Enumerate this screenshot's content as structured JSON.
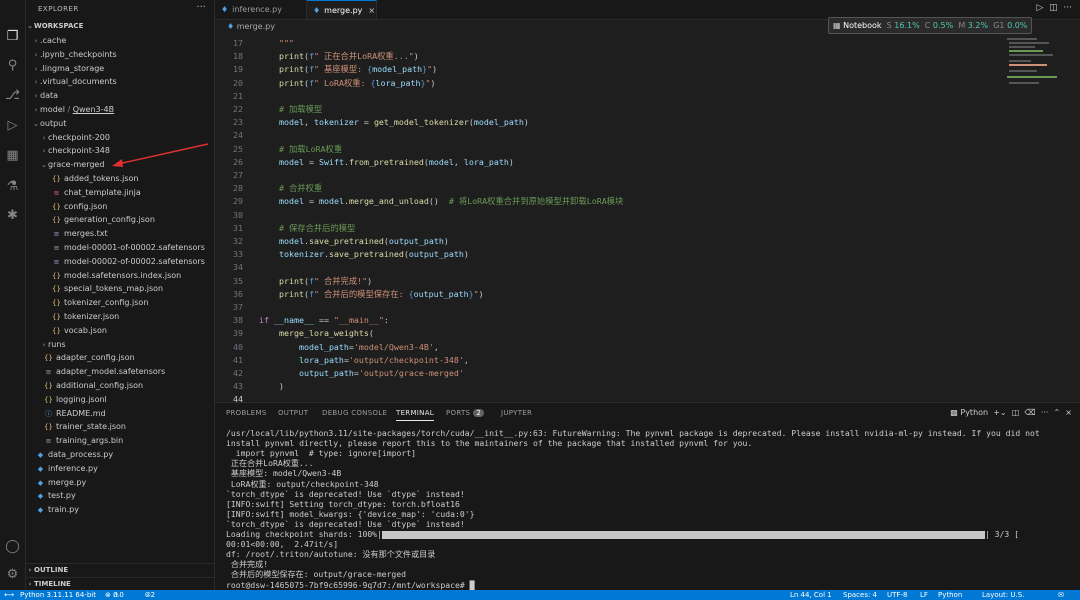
{
  "sidebar": {
    "title": "EXPLORER",
    "workspace": "WORKSPACE",
    "outline": "OUTLINE",
    "timeline": "TIMELINE",
    "items": [
      {
        "label": "cache-folder",
        "text": ".cache",
        "depth": 1,
        "type": "folder",
        "open": false
      },
      {
        "label": "ipynb",
        "text": ".ipynb_checkpoints",
        "depth": 1,
        "type": "folder",
        "open": false
      },
      {
        "label": "lingma",
        "text": ".lingma_storage",
        "depth": 1,
        "type": "folder",
        "open": false
      },
      {
        "label": "virtual-docs",
        "text": ".virtual_documents",
        "depth": 1,
        "type": "folder",
        "open": false
      },
      {
        "label": "data",
        "text": "data",
        "depth": 1,
        "type": "folder",
        "open": false
      },
      {
        "label": "model",
        "text": "model",
        "sub": "Qwen3-4B",
        "depth": 1,
        "type": "folder",
        "open": false
      },
      {
        "label": "output",
        "text": "output",
        "depth": 1,
        "type": "folder",
        "open": true
      },
      {
        "label": "checkpoint-200",
        "text": "checkpoint-200",
        "depth": 2,
        "type": "folder",
        "open": false
      },
      {
        "label": "checkpoint-348",
        "text": "checkpoint-348",
        "depth": 2,
        "type": "folder",
        "open": false
      },
      {
        "label": "grace-merged",
        "text": "grace-merged",
        "depth": 2,
        "type": "folder",
        "open": true
      },
      {
        "label": "added-tokens",
        "text": "added_tokens.json",
        "depth": 3,
        "type": "json"
      },
      {
        "label": "chat-template",
        "text": "chat_template.jinja",
        "depth": 3,
        "type": "jinja"
      },
      {
        "label": "config",
        "text": "config.json",
        "depth": 3,
        "type": "json"
      },
      {
        "label": "generation-config",
        "text": "generation_config.json",
        "depth": 3,
        "type": "json"
      },
      {
        "label": "merges",
        "text": "merges.txt",
        "depth": 3,
        "type": "txt"
      },
      {
        "label": "model-1",
        "text": "model-00001-of-00002.safetensors",
        "depth": 3,
        "type": "txt"
      },
      {
        "label": "model-2",
        "text": "model-00002-of-00002.safetensors",
        "depth": 3,
        "type": "txt"
      },
      {
        "label": "model-index",
        "text": "model.safetensors.index.json",
        "depth": 3,
        "type": "json"
      },
      {
        "label": "special-tokens",
        "text": "special_tokens_map.json",
        "depth": 3,
        "type": "json"
      },
      {
        "label": "tokenizer-config",
        "text": "tokenizer_config.json",
        "depth": 3,
        "type": "json"
      },
      {
        "label": "tokenizer",
        "text": "tokenizer.json",
        "depth": 3,
        "type": "json"
      },
      {
        "label": "vocab",
        "text": "vocab.json",
        "depth": 3,
        "type": "json"
      },
      {
        "label": "runs",
        "text": "runs",
        "depth": 2,
        "type": "folder",
        "open": false
      },
      {
        "label": "adapter-config",
        "text": "adapter_config.json",
        "depth": 2,
        "type": "json"
      },
      {
        "label": "adapter-model",
        "text": "adapter_model.safetensors",
        "depth": 2,
        "type": "txt"
      },
      {
        "label": "additional-config",
        "text": "additional_config.json",
        "depth": 2,
        "type": "json"
      },
      {
        "label": "logging",
        "text": "logging.jsonl",
        "depth": 2,
        "type": "json"
      },
      {
        "label": "readme",
        "text": "README.md",
        "depth": 2,
        "type": "md"
      },
      {
        "label": "trainer-state",
        "text": "trainer_state.json",
        "depth": 2,
        "type": "json"
      },
      {
        "label": "training-args",
        "text": "training_args.bin",
        "depth": 2,
        "type": "txt"
      },
      {
        "label": "data-process",
        "text": "data_process.py",
        "depth": 1,
        "type": "py"
      },
      {
        "label": "inference-py",
        "text": "inference.py",
        "depth": 1,
        "type": "py"
      },
      {
        "label": "merge-py",
        "text": "merge.py",
        "depth": 1,
        "type": "py"
      },
      {
        "label": "test-py",
        "text": "test.py",
        "depth": 1,
        "type": "py"
      },
      {
        "label": "train-py",
        "text": "train.py",
        "depth": 1,
        "type": "py"
      }
    ]
  },
  "tabs": [
    {
      "label": "inference.py",
      "active": false
    },
    {
      "label": "merge.py",
      "active": true
    }
  ],
  "breadcrumb": "merge.py",
  "notebook": {
    "label": "Notebook",
    "s_label": "S",
    "s_val": "16.1%",
    "c_label": "C",
    "c_val": "0.5%",
    "m_label": "M",
    "m_val": "3.2%",
    "g_label": "G1",
    "g_val": "0.0%"
  },
  "editor": {
    "lines": [
      {
        "n": "17",
        "html": "    <span class='s'>\"\"\"</span>"
      },
      {
        "n": "18",
        "html": "    <span class='f'>print</span>(<span class='b'>f</span><span class='s'>\" 正在合并LoRA权重...\"</span>)"
      },
      {
        "n": "19",
        "html": "    <span class='f'>print</span>(<span class='b'>f</span><span class='s'>\" 基座模型: </span><span class='b'>{</span><span class='v'>model_path</span><span class='b'>}</span><span class='s'>\"</span>)"
      },
      {
        "n": "20",
        "html": "    <span class='f'>print</span>(<span class='b'>f</span><span class='s'>\" LoRA权重: </span><span class='b'>{</span><span class='v'>lora_path</span><span class='b'>}</span><span class='s'>\"</span>)"
      },
      {
        "n": "21",
        "html": ""
      },
      {
        "n": "22",
        "html": "    <span class='c'># 加载模型</span>"
      },
      {
        "n": "23",
        "html": "    <span class='v'>model</span>, <span class='v'>tokenizer</span> = <span class='f'>get_model_tokenizer</span>(<span class='v'>model_path</span>)"
      },
      {
        "n": "24",
        "html": ""
      },
      {
        "n": "25",
        "html": "    <span class='c'># 加载LoRA权重</span>"
      },
      {
        "n": "26",
        "html": "    <span class='v'>model</span> = <span class='v'>Swift</span>.<span class='f'>from_pretrained</span>(<span class='v'>model</span>, <span class='v'>lora_path</span>)"
      },
      {
        "n": "27",
        "html": ""
      },
      {
        "n": "28",
        "html": "    <span class='c'># 合并权重</span>"
      },
      {
        "n": "29",
        "html": "    <span class='v'>model</span> = <span class='v'>model</span>.<span class='f'>merge_and_unload</span>()  <span class='c'># 将LoRA权重合并到原始模型并卸载LoRA模块</span>"
      },
      {
        "n": "30",
        "html": ""
      },
      {
        "n": "31",
        "html": "    <span class='c'># 保存合并后的模型</span>"
      },
      {
        "n": "32",
        "html": "    <span class='v'>model</span>.<span class='f'>save_pretrained</span>(<span class='v'>output_path</span>)"
      },
      {
        "n": "33",
        "html": "    <span class='v'>tokenizer</span>.<span class='f'>save_pretrained</span>(<span class='v'>output_path</span>)"
      },
      {
        "n": "34",
        "html": ""
      },
      {
        "n": "35",
        "html": "    <span class='f'>print</span>(<span class='b'>f</span><span class='s'>\" 合并完成!\"</span>)"
      },
      {
        "n": "36",
        "html": "    <span class='f'>print</span>(<span class='b'>f</span><span class='s'>\" 合并后的模型保存在: </span><span class='b'>{</span><span class='v'>output_path</span><span class='b'>}</span><span class='s'>\"</span>)"
      },
      {
        "n": "37",
        "html": ""
      },
      {
        "n": "38",
        "html": "<span class='k'>if</span> <span class='v'>__name__</span> == <span class='s'>\"__main__\"</span>:"
      },
      {
        "n": "39",
        "html": "    <span class='f'>merge_lora_weights</span>("
      },
      {
        "n": "40",
        "html": "        <span class='v'>model_path</span>=<span class='s'>'model/Qwen3-4B'</span>,"
      },
      {
        "n": "41",
        "html": "        <span class='v'>lora_path</span>=<span class='s'>'output/checkpoint-348'</span>,"
      },
      {
        "n": "42",
        "html": "        <span class='v'>output_path</span>=<span class='s'>'output/grace-merged'</span>"
      },
      {
        "n": "43",
        "html": "    )"
      },
      {
        "n": "44",
        "html": ""
      }
    ]
  },
  "panel": {
    "tabs": [
      "PROBLEMS",
      "OUTPUT",
      "DEBUG CONSOLE",
      "TERMINAL",
      "PORTS",
      "JUPYTER"
    ],
    "ports_badge": "2",
    "shell": "Python",
    "terminal_lines": [
      "/usr/local/lib/python3.11/site-packages/torch/cuda/__init__.py:63: FutureWarning: The pynvml package is deprecated. Please install nvidia-ml-py instead. If you did not",
      "install pynvml directly, please report this to the maintainers of the package that installed pynvml for you.",
      "  import pynvml  # type: ignore[import]",
      " 正在合并LoRA权重...",
      " 基座模型: model/Qwen3-4B",
      " LoRA权重: output/checkpoint-348",
      "`torch_dtype` is deprecated! Use `dtype` instead!",
      "[INFO:swift] Setting torch_dtype: torch.bfloat16",
      "[INFO:swift] model_kwargs: {'device_map': 'cuda:0'}",
      "`torch_dtype` is deprecated! Use `dtype` instead!",
      "Loading checkpoint shards: 100%|",
      "00:01<00:00,  2.47it/s]",
      "df: /root/.triton/autotune: 没有那个文件或目录",
      " 合并完成!",
      " 合并后的模型保存在: output/grace-merged",
      "root@dsw-1465075-7bf9c65996-9q7d7:/mnt/workspace# "
    ],
    "progress_tail": "| 3/3 [",
    "progress_fraction": 1.0
  },
  "status": {
    "python": "Python 3.11.11 64-bit",
    "errors": "0",
    "warnings": "0",
    "ports": "2",
    "position": "Ln 44, Col 1",
    "spaces": "Spaces: 4",
    "encoding": "UTF-8",
    "eol": "LF",
    "language": "Python",
    "layout": "Layout: U.S."
  },
  "colors": {
    "accent": "#0078d4",
    "statusbar": "#0078d4",
    "annotation_arrow": "#e03030"
  }
}
